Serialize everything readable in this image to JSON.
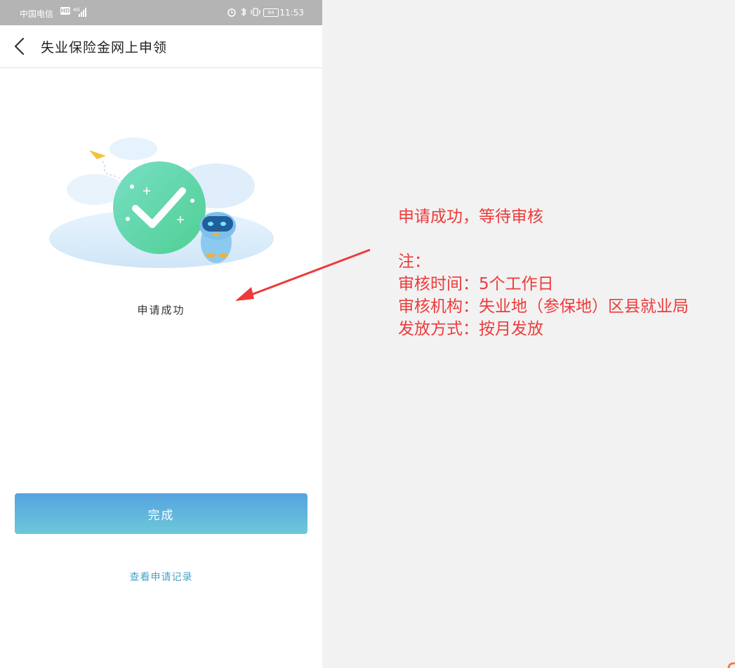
{
  "status_bar": {
    "carrier": "中国电信",
    "hd_badge": "HD",
    "network": "4G",
    "time": "11:53",
    "battery": "84"
  },
  "header": {
    "title": "失业保险金网上申领"
  },
  "main": {
    "success_text": "申请成功",
    "done_button": "完成",
    "records_link": "查看申请记录"
  },
  "annotation": {
    "heading": "申请成功，等待审核",
    "note_label": "注：",
    "lines": [
      "审核时间：5个工作日",
      "审核机构：失业地（参保地）区县就业局",
      "发放方式：按月发放"
    ]
  },
  "colors": {
    "accent_start": "#55a3e0",
    "accent_end": "#6cc8d9",
    "annotation_red": "#ee3a3a",
    "check_green": "#5dd6a9",
    "link": "#4aa3c9"
  }
}
